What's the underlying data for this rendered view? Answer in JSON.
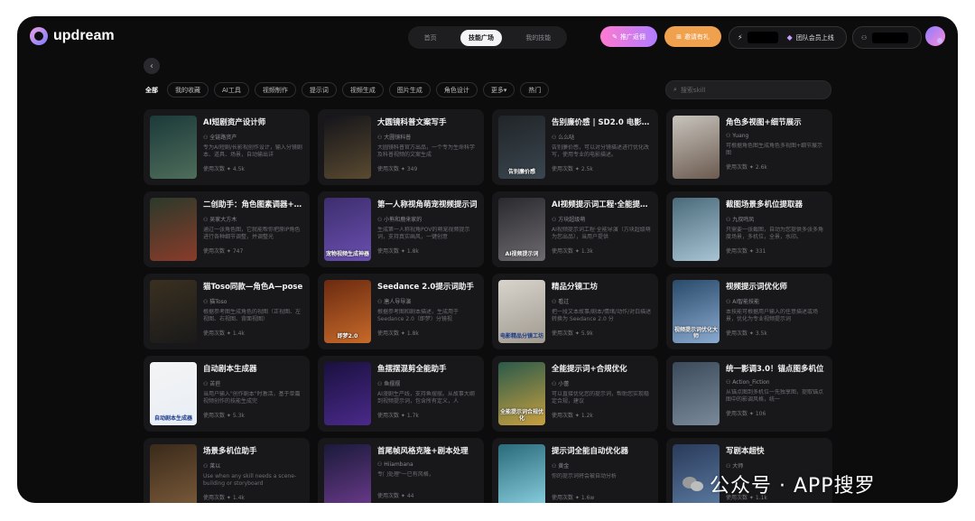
{
  "brand": {
    "name": "updream"
  },
  "topnav": {
    "items": [
      "首页",
      "技能广场",
      "我的技能"
    ],
    "active": 1
  },
  "header": {
    "promo_label": "推广返佣",
    "invite_label": "邀请有礼",
    "team_label": "团队会员上线"
  },
  "filters": {
    "chips": [
      "全部",
      "我的收藏",
      "AI工具",
      "视频制作",
      "提示词",
      "视频生成",
      "图片生成",
      "角色设计",
      "更多",
      "热门"
    ],
    "active": 0,
    "search_placeholder": "搜索skill"
  },
  "cards": [
    {
      "title": "AI短剧资产设计师",
      "author": "全链路资产",
      "desc": "专为AI短剧/长影视创作设计，输入分镜剧本、道具、场景，自动输出详",
      "usage": "使用次数 ✦ 4.5k",
      "thumb_text": "",
      "bg": [
        "#1b3a3a",
        "#4f6d5a"
      ]
    },
    {
      "title": "大圆镜科普文案写手",
      "author": "大圆镜科普",
      "desc": "大圆镜科普官方出品，一个专为生命科学及科普视频的文案生成",
      "usage": "使用次数 ✦ 349",
      "thumb_text": "",
      "bg": [
        "#14141a",
        "#5a4a30"
      ]
    },
    {
      "title": "告别廉价感 | SD2.0 电影质感提示词",
      "author": "么么哒",
      "desc": "告别廉价感，可以对分镜描述进行优化改写，使用专业的电影描述。",
      "usage": "使用次数 ✦ 2.5k",
      "thumb_text": "告别廉价感",
      "bg": [
        "#202528",
        "#3b4650"
      ]
    },
    {
      "title": "角色多视图+细节展示",
      "author": "Yuang",
      "desc": "可根据角色图生成角色多视图+细节展示图",
      "usage": "使用次数 ✦ 2.6k",
      "thumb_text": "",
      "bg": [
        "#c8c4bd",
        "#6b5a4f"
      ]
    },
    {
      "title": "二创助手：角色图素调器+手绘",
      "author": "吴家大方木",
      "desc": "通过一张角色图，它就能帮你把原IP角色进行各种细节调整，并调整光",
      "usage": "使用次数 ✦ 747",
      "thumb_text": "",
      "bg": [
        "#2b3a2a",
        "#8a3b2a"
      ]
    },
    {
      "title": "第一人称视角萌宠视频提示词",
      "author": "小熊和鹿来家的",
      "desc": "生成第一人称视角POV的萌宠视频提示词，支持真实画风，一键创意",
      "usage": "使用次数 ✦ 1.8k",
      "thumb_text": "宠物视频生成神器",
      "bg": [
        "#3d2e6e",
        "#6a4fb0"
      ]
    },
    {
      "title": "AI视频提示词工程·全能提示词",
      "author": "方块超级萌",
      "desc": "AI视频提示词工程·全能导演（方块超级萌为您出品），当用户提供",
      "usage": "使用次数 ✦ 1.3k",
      "thumb_text": "AI视频提示词",
      "bg": [
        "#2a2a2e",
        "#6d6a70"
      ]
    },
    {
      "title": "截图场景多机位提取器",
      "author": "九叔鸣凤",
      "desc": "只需要一张截图，自动为您提供多张多角度场景，多机位，全景，水印。",
      "usage": "使用次数 ✦ 331",
      "thumb_text": "",
      "bg": [
        "#4a6a7a",
        "#a8c4d4"
      ]
    },
    {
      "title": "猫Toso同款—角色A—pose",
      "author": "猫Toso",
      "desc": "根据参考图生成角色的视图（正视图、左视图、右视图、背面视图）",
      "usage": "使用次数 ✦ 1.4k",
      "thumb_text": "",
      "bg": [
        "#3a3020",
        "#1a1a1a"
      ]
    },
    {
      "title": "Seedance 2.0提示词助手",
      "author": "唐人导导演",
      "desc": "根据参考图和剧本描述，生成用于 Seedance 2.0（即梦）分镜视",
      "usage": "使用次数 ✦ 1.8k",
      "thumb_text": "即梦2.0",
      "bg": [
        "#6a2a10",
        "#c86a2a"
      ]
    },
    {
      "title": "精品分镜工坊",
      "author": "看过",
      "desc": "把一段文本故事/剧本/情绪/动作/对白描述转换为 Seedance 2.0 分",
      "usage": "使用次数 ✦ 5.9k",
      "thumb_text": "电影精品分镜工坊",
      "bg": [
        "#d8d4cc",
        "#a09a90"
      ]
    },
    {
      "title": "视频提示词优化师",
      "author": "AI智能技能",
      "desc": "本技能可根据用户输入的任意描述或场景，优化为专业视频提示词",
      "usage": "使用次数 ✦ 3.5k",
      "thumb_text": "视频提示词优化大师",
      "bg": [
        "#2a4a6a",
        "#8aaad0"
      ]
    },
    {
      "title": "自动剧本生成器",
      "author": "苦苣",
      "desc": "当用户输入\"创作剧本\"时激活，基于单篇视频创作的技能生成完",
      "usage": "使用次数 ✦ 5.3k",
      "thumb_text": "自动剧本生成器",
      "bg": [
        "#f4f4f4",
        "#e8eef6"
      ]
    },
    {
      "title": "鱼摆摆混剪全能助手",
      "author": "鱼摆摆",
      "desc": "AI漫剧生产线，支持鱼摆摆。从故事大纲到视频提示词，包含所有定义，人",
      "usage": "使用次数 ✦ 1.7k",
      "thumb_text": "",
      "bg": [
        "#1a1040",
        "#4a2a8a"
      ]
    },
    {
      "title": "全能提示词+合规优化",
      "author": "小蕾",
      "desc": "可以直接优化您的提示词，帮助您实现稳定合规，建议",
      "usage": "使用次数 ✦ 1.2k",
      "thumb_text": "全能提示词合规优化",
      "bg": [
        "#2a5a4a",
        "#c8a040"
      ]
    },
    {
      "title": "统一影调3.0！锚点图多机位",
      "author": "Action_Fiction",
      "desc": "从锚点图到多机位一先独享图，提取锚点图中的影调风格，统一",
      "usage": "使用次数 ✦ 106",
      "thumb_text": "",
      "bg": [
        "#3a4a5a",
        "#7a8a9a"
      ]
    },
    {
      "title": "场景多机位助手",
      "author": "莱以",
      "desc": "Use when any skill needs a scene-building or storyboard",
      "usage": "使用次数 ✦ 1.4k",
      "thumb_text": "",
      "bg": [
        "#3a2a1a",
        "#7a5a3a"
      ]
    },
    {
      "title": "首尾帧风格克隆+剧本处理",
      "author": "Hiiambana",
      "desc": "专门处理\"一已有风格，",
      "usage": "使用次数 ✦ 44",
      "thumb_text": "",
      "bg": [
        "#1a1a3a",
        "#6a3a8a"
      ]
    },
    {
      "title": "提示词全能自动优化器",
      "author": "黄金",
      "desc": "你的提示词将会被自动分析",
      "usage": "使用次数 ✦ 1.6w",
      "thumb_text": "",
      "bg": [
        "#2a6a7a",
        "#8ad0e0"
      ]
    },
    {
      "title": "写剧本超快",
      "author": "大师",
      "desc": "",
      "usage": "使用次数 ✦ 1.1k",
      "thumb_text": "",
      "bg": [
        "#2a3a5a",
        "#5a7aa0"
      ]
    }
  ],
  "watermark": {
    "text": "公众号 · APP搜罗"
  }
}
